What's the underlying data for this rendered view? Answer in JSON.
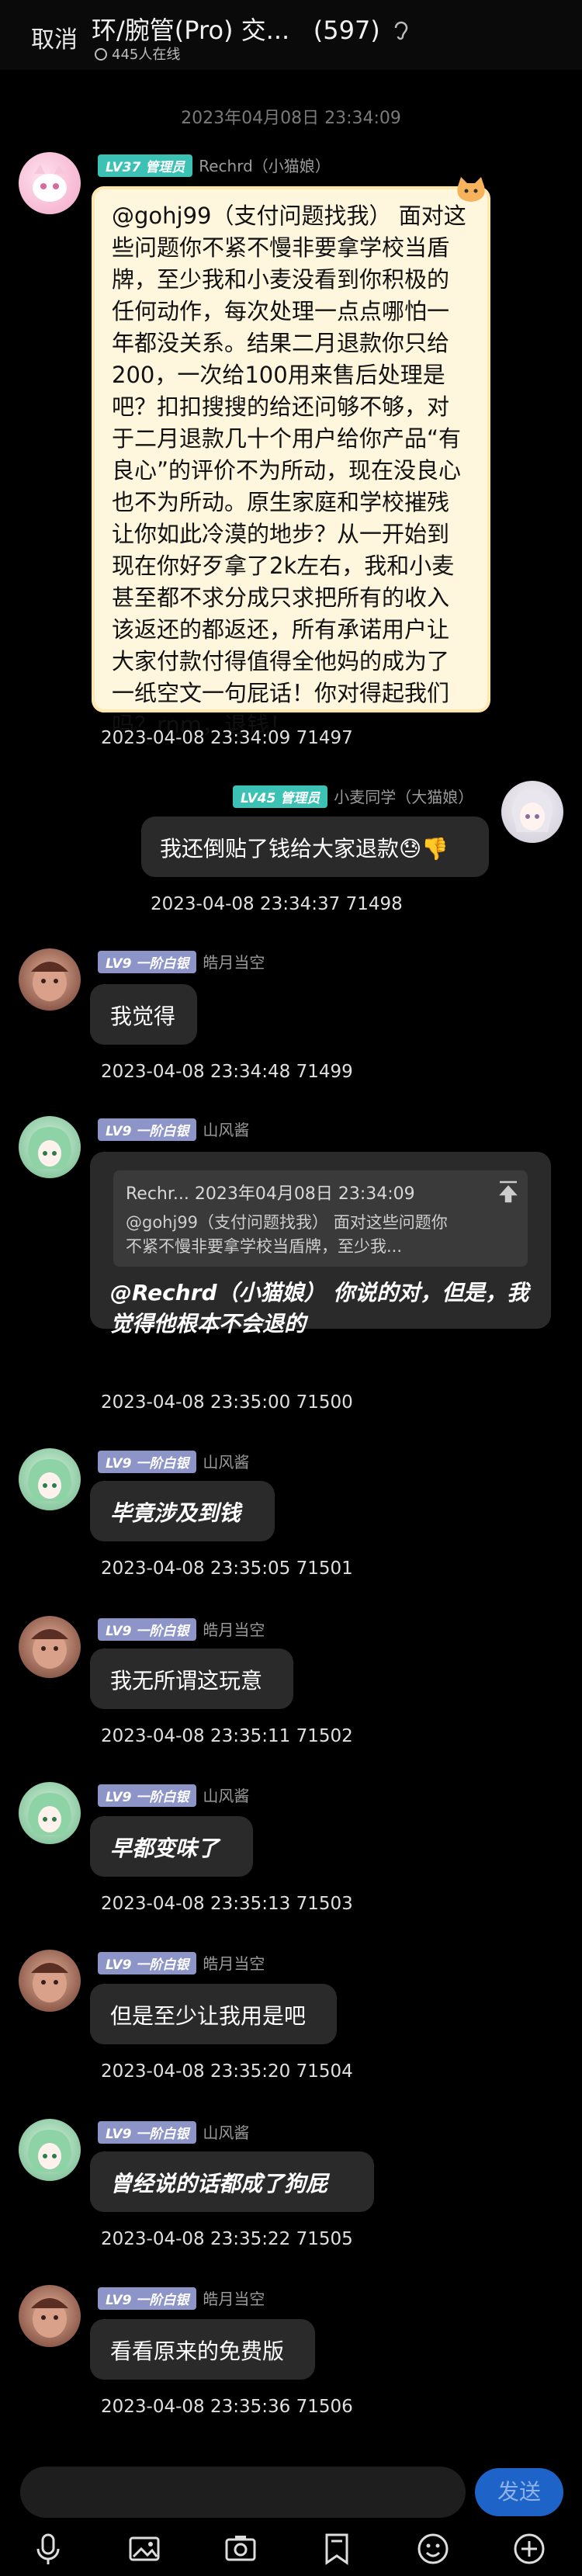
{
  "header": {
    "cancel": "取消",
    "title": "环/腕管(Pro) 交...",
    "count": "(597)",
    "online": "445人在线"
  },
  "time_header": "2023年04月08日 23:34:09",
  "messages": [
    {
      "badge": "LV37 管理员",
      "nick": "Rechrd（小猫娘）",
      "text": "@gohj99（支付问题找我） 面对这些问题你不紧不慢非要拿学校当盾牌，至少我和小麦没看到你积极的任何动作，每次处理一点点哪怕一年都没关系。结果二月退款你只给200，一次给100用来售后处理是吧？扣扣搜搜的给还问够不够，对于二月退款几十个用户给你产品“有良心”的评价不为所动，现在没良心也不为所动。原生家庭和学校摧残让你如此冷漠的地步？从一开始到现在你好歹拿了2k左右，我和小麦甚至都不求分成只求把所有的收入该返还的都返还，所有承诺用户让大家付款付得值得全他妈的成为了一纸空文一句屁话！你对得起我们吗？rnm，退钱！",
      "meta": "2023-04-08 23:34:09 71497"
    },
    {
      "badge": "LV45 管理员",
      "nick": "小麦同学（大猫娘）",
      "text": "我还倒贴了钱给大家退款😓👎",
      "meta": "2023-04-08 23:34:37 71498"
    },
    {
      "badge": "LV9 一阶白银",
      "nick": "皓月当空",
      "text": "我觉得",
      "meta": "2023-04-08 23:34:48 71499"
    },
    {
      "badge": "LV9 一阶白银",
      "nick": "山风酱",
      "quote_head": "Rechr... 2023年04月08日 23:34:09",
      "quote_text": "@gohj99（支付问题找我） 面对这些问题你不紧不慢非要拿学校当盾牌，至少我...",
      "text": "@Rechrd（小猫娘） 你说的对，但是，我觉得他根本不会退的",
      "meta": "2023-04-08 23:35:00 71500"
    },
    {
      "badge": "LV9 一阶白银",
      "nick": "山风酱",
      "text": "毕竟涉及到钱",
      "meta": "2023-04-08 23:35:05 71501"
    },
    {
      "badge": "LV9 一阶白银",
      "nick": "皓月当空",
      "text": "我无所谓这玩意",
      "meta": "2023-04-08 23:35:11 71502"
    },
    {
      "badge": "LV9 一阶白银",
      "nick": "山风酱",
      "text": "早都变味了",
      "meta": "2023-04-08 23:35:13 71503"
    },
    {
      "badge": "LV9 一阶白银",
      "nick": "皓月当空",
      "text": "但是至少让我用是吧",
      "meta": "2023-04-08 23:35:20 71504"
    },
    {
      "badge": "LV9 一阶白银",
      "nick": "山风酱",
      "text": "曾经说的话都成了狗屁",
      "meta": "2023-04-08 23:35:22 71505"
    },
    {
      "badge": "LV9 一阶白银",
      "nick": "皓月当空",
      "text": "看看原来的免费版",
      "meta": "2023-04-08 23:35:36 71506"
    }
  ],
  "input": {
    "placeholder": "",
    "send": "发送"
  },
  "toolbar": [
    "microphone-icon",
    "image-icon",
    "camera-icon",
    "bookmark-icon",
    "emoji-icon",
    "plus-icon"
  ],
  "colors": {
    "admin_badge": "#3cc1b5",
    "white_badge": "#8d95c8",
    "send_button": "#1e64c8",
    "long_bubble": "#fff6de"
  }
}
